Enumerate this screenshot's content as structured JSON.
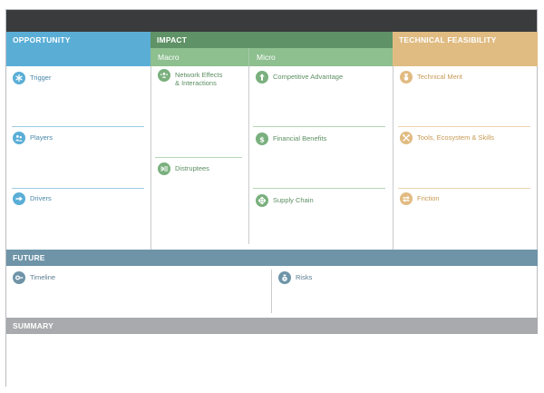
{
  "sections": {
    "opportunity": {
      "title": "OPPORTUNITY",
      "items": [
        {
          "label": "Trigger",
          "icon": "asterisk-icon"
        },
        {
          "label": "Players",
          "icon": "people-icon"
        },
        {
          "label": "Drivers",
          "icon": "arrow-right-icon"
        }
      ]
    },
    "impact": {
      "title": "IMPACT",
      "macro": {
        "title": "Macro",
        "items": [
          {
            "label": "Network Effects\n& Interactions",
            "icon": "network-icon"
          },
          {
            "label": "Distruptees",
            "icon": "burst-icon"
          }
        ]
      },
      "micro": {
        "title": "Micro",
        "items": [
          {
            "label": "Competitive Advantage",
            "icon": "arrow-up-icon"
          },
          {
            "label": "Financial Benefits",
            "icon": "dollar-icon"
          },
          {
            "label": "Supply Chain",
            "icon": "supply-chain-icon"
          }
        ]
      }
    },
    "technical": {
      "title": "TECHNICAL FEASIBILITY",
      "items": [
        {
          "label": "Technical Merit",
          "icon": "medal-icon"
        },
        {
          "label": "Tools, Ecosystem & Skills",
          "icon": "tools-icon"
        },
        {
          "label": "Friction",
          "icon": "friction-icon"
        }
      ]
    },
    "future": {
      "title": "FUTURE",
      "items": [
        {
          "label": "Timeline",
          "icon": "timeline-icon"
        },
        {
          "label": "Risks",
          "icon": "risk-icon"
        }
      ]
    },
    "summary": {
      "title": "SUMMARY"
    }
  },
  "colors": {
    "topbar": "#3a3b3d",
    "opportunity": "#5aaed6",
    "impact": "#5f9266",
    "impact_sub": "#8dbf8f",
    "technical": "#e0bc82",
    "future": "#6f94a8",
    "summary": "#a8aaad"
  }
}
